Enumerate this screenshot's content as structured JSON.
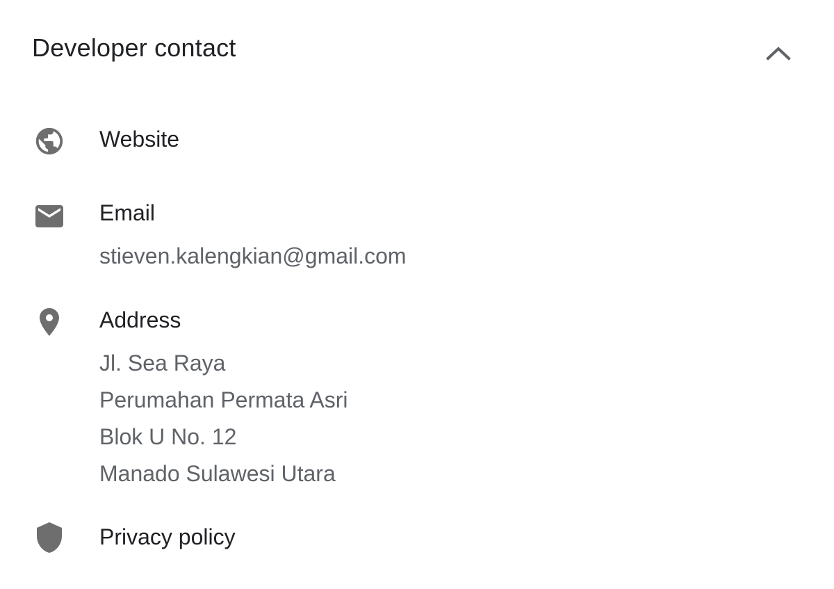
{
  "section": {
    "title": "Developer contact",
    "collapse_icon": "chevron-up-icon"
  },
  "items": {
    "website": {
      "icon": "globe-icon",
      "label": "Website"
    },
    "email": {
      "icon": "envelope-icon",
      "label": "Email",
      "value": "stieven.kalengkian@gmail.com"
    },
    "address": {
      "icon": "location-pin-icon",
      "label": "Address",
      "lines": [
        "Jl. Sea Raya",
        "Perumahan Permata Asri",
        "Blok U No. 12",
        "Manado Sulawesi Utara"
      ]
    },
    "privacy": {
      "icon": "shield-icon",
      "label": "Privacy policy"
    }
  },
  "colors": {
    "icon": "#6e6e6e",
    "primary_text": "#202124",
    "secondary_text": "#5f6368"
  }
}
